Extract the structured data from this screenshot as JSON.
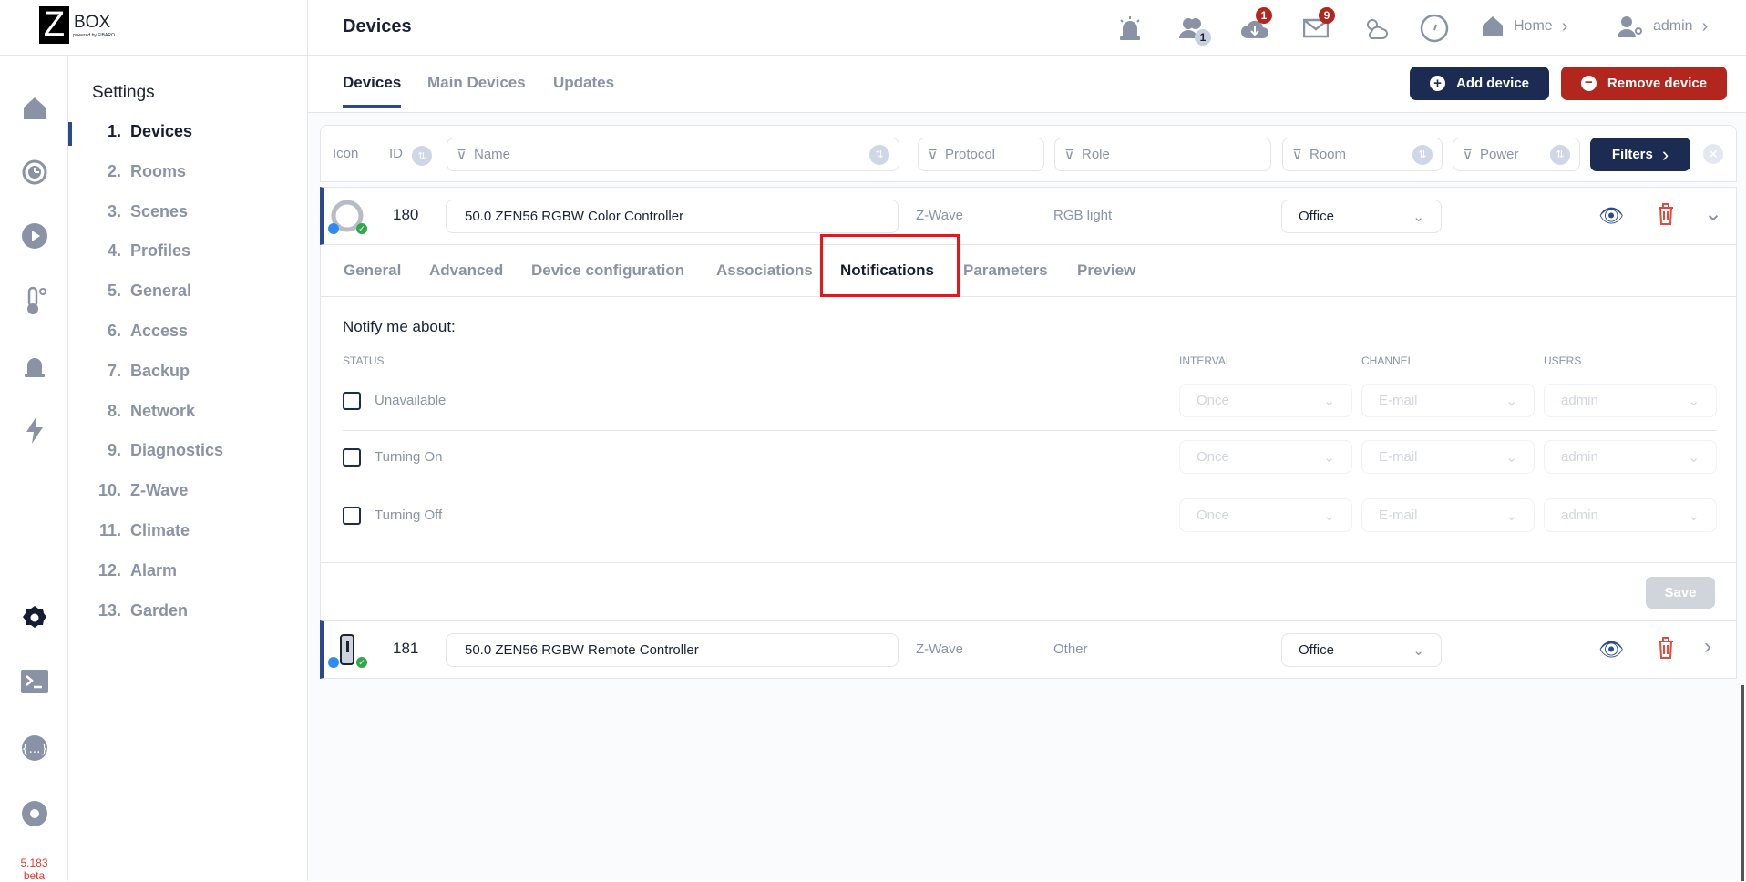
{
  "app": {
    "logo_letter": "Z",
    "logo_text": "BOX",
    "logo_sub": "powered by FIBARO",
    "version": "5.183",
    "version_suffix": "beta"
  },
  "header": {
    "title": "Devices",
    "badges": {
      "users": "1",
      "updates": "1",
      "messages": "9"
    },
    "home_label": "Home",
    "user_label": "admin"
  },
  "sidebar": {
    "title": "Settings",
    "items": [
      {
        "num": "1.",
        "label": "Devices"
      },
      {
        "num": "2.",
        "label": "Rooms"
      },
      {
        "num": "3.",
        "label": "Scenes"
      },
      {
        "num": "4.",
        "label": "Profiles"
      },
      {
        "num": "5.",
        "label": "General"
      },
      {
        "num": "6.",
        "label": "Access"
      },
      {
        "num": "7.",
        "label": "Backup"
      },
      {
        "num": "8.",
        "label": "Network"
      },
      {
        "num": "9.",
        "label": "Diagnostics"
      },
      {
        "num": "10.",
        "label": "Z-Wave"
      },
      {
        "num": "11.",
        "label": "Climate"
      },
      {
        "num": "12.",
        "label": "Alarm"
      },
      {
        "num": "13.",
        "label": "Garden"
      }
    ]
  },
  "tabs": [
    "Devices",
    "Main Devices",
    "Updates"
  ],
  "actions": {
    "add": "Add device",
    "remove": "Remove device"
  },
  "filters": {
    "icon": "Icon",
    "id": "ID",
    "name": "Name",
    "protocol": "Protocol",
    "role": "Role",
    "room": "Room",
    "power": "Power",
    "button": "Filters"
  },
  "devices": [
    {
      "id": "180",
      "name": "50.0 ZEN56 RGBW Color Controller",
      "protocol": "Z-Wave",
      "role": "RGB light",
      "room": "Office"
    },
    {
      "id": "181",
      "name": "50.0 ZEN56 RGBW Remote Controller",
      "protocol": "Z-Wave",
      "role": "Other",
      "room": "Office"
    }
  ],
  "device_tabs": [
    "General",
    "Advanced",
    "Device configuration",
    "Associations",
    "Notifications",
    "Parameters",
    "Preview"
  ],
  "notifications": {
    "heading": "Notify me about:",
    "col_status": "STATUS",
    "col_interval": "INTERVAL",
    "col_channel": "CHANNEL",
    "col_users": "USERS",
    "rows": [
      {
        "label": "Unavailable",
        "interval": "Once",
        "channel": "E-mail",
        "users": "admin"
      },
      {
        "label": "Turning On",
        "interval": "Once",
        "channel": "E-mail",
        "users": "admin"
      },
      {
        "label": "Turning Off",
        "interval": "Once",
        "channel": "E-mail",
        "users": "admin"
      }
    ],
    "save": "Save"
  },
  "colors": {
    "navy": "#1b2b52",
    "red": "#b3261e",
    "highlight": "#e8161b"
  }
}
